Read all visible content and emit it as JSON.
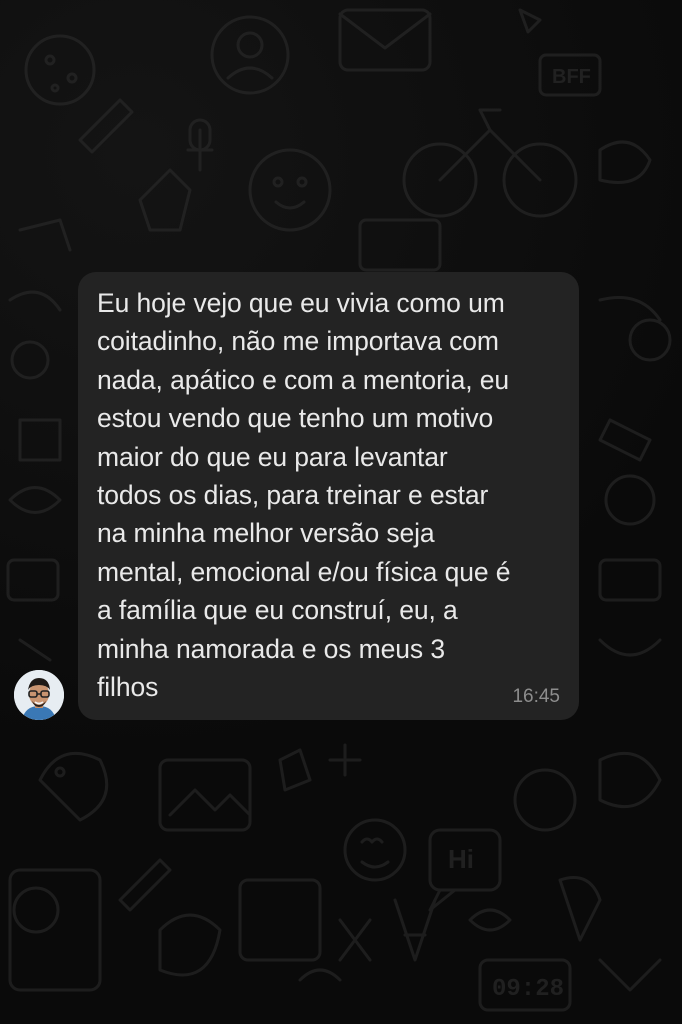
{
  "chat": {
    "message": {
      "text": "Eu hoje vejo que eu vivia como um\ncoitadinho, não me importava com\nnada, apático e com a mentoria, eu\nestou vendo que tenho um motivo\nmaior do que eu para levantar\ntodos os dias, para treinar e estar\nna minha melhor versão seja\nmental, emocional e/ou física que é\na família que eu construí, eu, a\nminha namorada e os meus 3\nfilhos",
      "time": "16:45"
    },
    "sender": {
      "avatar_icon": "person-avatar"
    },
    "wallpaper": {
      "doodle_text_hi": "Hi",
      "doodle_text_clock": "09:28",
      "doodle_text_bff": "BFF"
    }
  },
  "colors": {
    "background": "#0a0a0a",
    "bubble": "#232323",
    "text": "#e9e9e9",
    "timestamp": "#8d8d8d",
    "doodle": "#2a2a2a"
  }
}
